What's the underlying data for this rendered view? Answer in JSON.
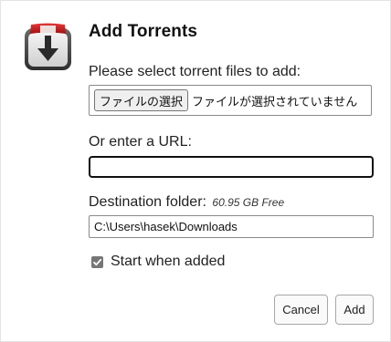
{
  "dialog": {
    "title": "Add Torrents",
    "app_icon": "transmission-icon"
  },
  "files": {
    "label": "Please select torrent files to add:",
    "button_label": "ファイルの選択",
    "status_text": "ファイルが選択されていません"
  },
  "url": {
    "label": "Or enter a URL:",
    "value": ""
  },
  "destination": {
    "label": "Destination folder:",
    "free_space": "60.95 GB Free",
    "value": "C:\\Users\\hasek\\Downloads"
  },
  "options": {
    "start_when_added_label": "Start when added",
    "start_when_added_checked": true
  },
  "actions": {
    "cancel_label": "Cancel",
    "add_label": "Add"
  },
  "colors": {
    "icon_red": "#c8151b",
    "checkbox": "#767676",
    "url_border": "#101010"
  }
}
